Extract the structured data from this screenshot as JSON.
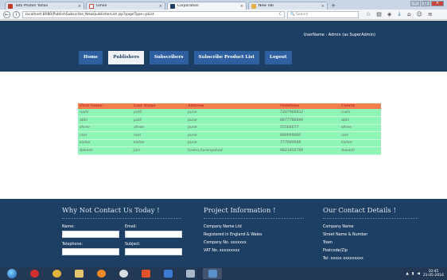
{
  "browser": {
    "tabs": [
      {
        "label": "Tata Photon Yahoo",
        "color": "#c0392b",
        "active": false
      },
      {
        "label": "Gmail",
        "color": "#d44638",
        "active": false
      },
      {
        "label": "Corporation",
        "color": "#1d3f63",
        "active": true
      },
      {
        "label": "New Tab",
        "color": "#e8b04a",
        "active": false
      }
    ],
    "new_tab": "+",
    "url": "localhost:8080/PublishSubscribe_New/publisherList.jsp?pageType=pList",
    "search_placeholder": "Search"
  },
  "header": {
    "user_line": "UserName : Admin (as SuperAdmin)"
  },
  "menu": [
    {
      "label": "Home",
      "active": false
    },
    {
      "label": "Publishers",
      "active": true
    },
    {
      "label": "Subscribers",
      "active": false
    },
    {
      "label": "Subscribe Product List",
      "active": false
    },
    {
      "label": "Logout",
      "active": false
    }
  ],
  "table": {
    "columns": [
      "First Name",
      "Last Name",
      "Address",
      "Mobileno",
      "Userid"
    ],
    "rows": [
      [
        "rushi",
        "patil",
        "pune",
        "7387968832",
        "rushi"
      ],
      [
        "abhi",
        "patil",
        "pune",
        "8877788899",
        "abhi"
      ],
      [
        "shree",
        "shree",
        "pune",
        "55566677",
        "shree"
      ],
      [
        "ram",
        "ram",
        "pune",
        "888999000",
        "ram"
      ],
      [
        "kishor",
        "kishor",
        "pune",
        "777889988",
        "kishor"
      ],
      [
        "Aakash",
        "Jain",
        "hadco,Aurangabad",
        "9823456789",
        "Aakash"
      ]
    ]
  },
  "footer": {
    "contact": {
      "title": "Why Not Contact Us Today !",
      "name_label": "Name:",
      "email_label": "Email:",
      "telephone_label": "Telephone:",
      "subject_label": "Subject:"
    },
    "project": {
      "title": "Project Information !",
      "lines": [
        "Company Name Ltd",
        "Registered in England & Wales",
        "Company No. xxxxxxx",
        "VAT No. xxxxxxxxx"
      ]
    },
    "details": {
      "title": "Our Contact Details !",
      "lines": [
        "Company Name",
        "Street Name & Number",
        "Town",
        "Postcode/Zip",
        "Tel: xxxxx xxxxxxxxx"
      ]
    }
  },
  "taskbar": {
    "time": "10:45",
    "date": "23-05-2016",
    "apps": [
      "start",
      "opera",
      "chrome",
      "explorer",
      "media-player",
      "browser",
      "firefox",
      "app",
      "tool",
      "window"
    ]
  },
  "colors": {
    "header_bg": "#1d3f63",
    "menu_bg": "#2e5fa1",
    "table_header_bg": "#f17f4e",
    "table_row_bg": "#8ff5b7"
  }
}
